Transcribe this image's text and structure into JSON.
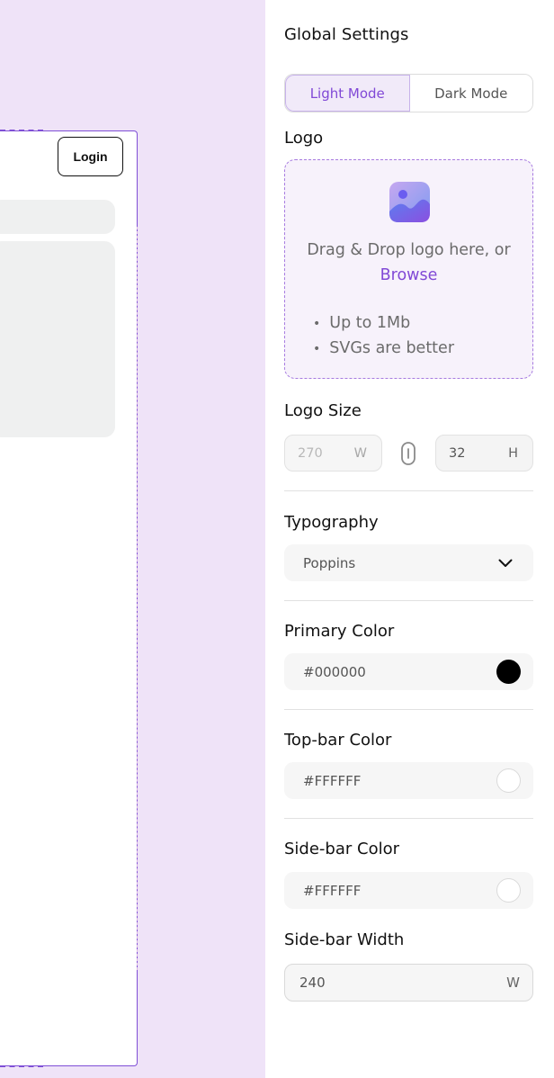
{
  "preview": {
    "login_label": "Login"
  },
  "settings": {
    "title": "Global Settings",
    "modes": {
      "light": "Light Mode",
      "dark": "Dark Mode",
      "selected": "Light Mode"
    },
    "logo": {
      "label": "Logo",
      "upload_icon": "image-icon",
      "drop_text": "Drag & Drop logo here, or",
      "browse": "Browse",
      "hints": [
        "Up to 1Mb",
        "SVGs are better"
      ]
    },
    "logo_size": {
      "label": "Logo Size",
      "width_value": "270",
      "width_unit": "W",
      "height_value": "32",
      "height_unit": "H",
      "link_icon": "link-icon"
    },
    "typography": {
      "label": "Typography",
      "value": "Poppins",
      "dropdown_icon": "chevron-down-icon"
    },
    "primary_color": {
      "label": "Primary Color",
      "value": "#000000",
      "swatch": "#000000"
    },
    "topbar_color": {
      "label": "Top-bar Color",
      "value": "#FFFFFF",
      "swatch": "#FFFFFF"
    },
    "sidebar_color": {
      "label": "Side-bar Color",
      "value": "#FFFFFF",
      "swatch": "#FFFFFF"
    },
    "sidebar_width": {
      "label": "Side-bar Width",
      "value": "240",
      "unit": "W"
    }
  },
  "colors": {
    "accent": "#8149d6",
    "canvas_bg": "#efe3f8",
    "panel_bg": "#ffffff"
  }
}
